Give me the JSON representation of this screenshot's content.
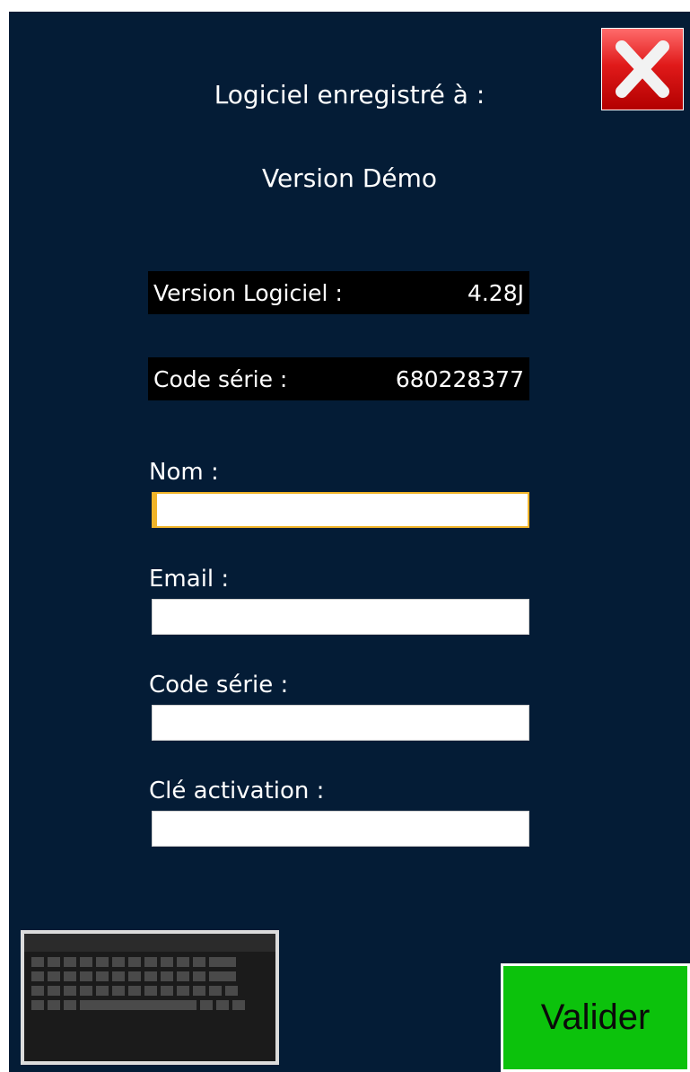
{
  "header": {
    "registered_label": "Logiciel enregistré à :",
    "registered_to": "Version Démo"
  },
  "info": {
    "version_label": "Version Logiciel :",
    "version_value": "4.28J",
    "serial_label": "Code série :",
    "serial_value": "680228377"
  },
  "form": {
    "name_label": "Nom :",
    "name_value": "",
    "email_label": "Email :",
    "email_value": "",
    "serial_label": "Code série :",
    "serial_value": "",
    "activation_label": "Clé activation :",
    "activation_value": ""
  },
  "actions": {
    "close_icon": "close-icon",
    "keyboard_icon": "keyboard-icon",
    "validate_label": "Valider"
  },
  "colors": {
    "background": "#041c36",
    "info_box": "#000000",
    "focus_border": "#f0b429",
    "validate_button": "#0cc20c",
    "close_button": "#e01a1a"
  }
}
